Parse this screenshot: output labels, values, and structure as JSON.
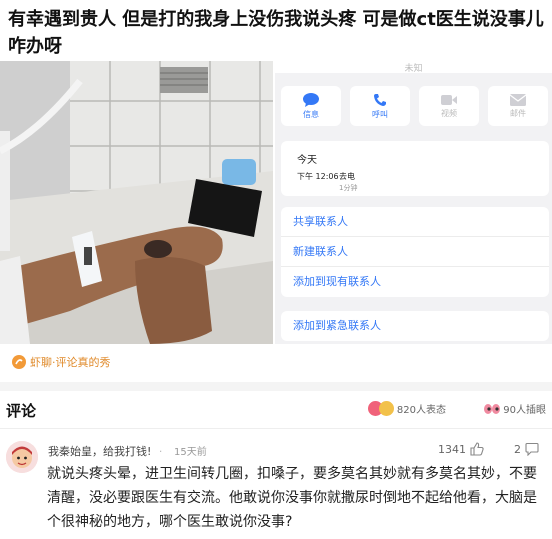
{
  "post": {
    "title": "有幸遇到贵人 但是打的我身上没伤我说头疼 可是做ct医生说没事儿咋办呀"
  },
  "phone_screen": {
    "header_text": "未知",
    "actions": [
      {
        "label": "信息",
        "icon": "message-icon"
      },
      {
        "label": "呼叫",
        "icon": "phone-icon"
      },
      {
        "label": "视频",
        "icon": "video-icon"
      },
      {
        "label": "邮件",
        "icon": "mail-icon"
      }
    ],
    "call_log": {
      "day": "今天",
      "time": "下午 12:06",
      "type": "去电",
      "duration": "1分钟"
    },
    "links_group1": [
      "共享联系人",
      "新建联系人",
      "添加到现有联系人"
    ],
    "links_group2": [
      "添加到紧急联系人"
    ]
  },
  "source": {
    "label": "虾聊·评论真的秀"
  },
  "comments_section": {
    "title": "评论",
    "reactions_label": "820人表态",
    "eyes_label": "90人插眼"
  },
  "comment": {
    "user": "我秦始皇，给我打钱!",
    "separator": "·",
    "time_ago": "15天前",
    "likes": "1341",
    "replies": "2",
    "text": "就说头疼头晕，进卫生间转几圈，扣嗓子，要多莫名其妙就有多莫名其妙，不要清醒，没必要跟医生有交流。他敢说你没事你就撒尿时倒地不起给他看，大脑是个很神秘的地方，哪个医生敢说你没事?"
  }
}
